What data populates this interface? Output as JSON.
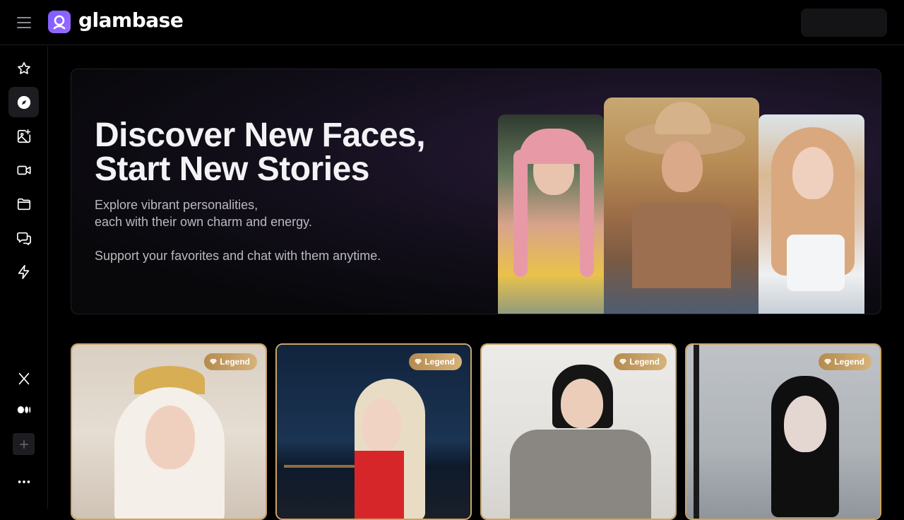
{
  "header": {
    "brand": "glambase"
  },
  "sidebar": {
    "items": [
      {
        "icon": "star-icon"
      },
      {
        "icon": "compass-icon",
        "active": true
      },
      {
        "icon": "image-plus-icon"
      },
      {
        "icon": "video-icon"
      },
      {
        "icon": "folder-icon"
      },
      {
        "icon": "chat-icon"
      },
      {
        "icon": "lightning-icon"
      }
    ],
    "footer": [
      {
        "icon": "x-icon"
      },
      {
        "icon": "medium-icon"
      },
      {
        "icon": "plus-icon"
      },
      {
        "icon": "more-icon"
      }
    ]
  },
  "hero": {
    "title_line1": "Discover New Faces,",
    "title_line2": "Start New Stories",
    "subtitle_line1": "Explore vibrant personalities,",
    "subtitle_line2": "each with their own charm and energy.",
    "subtitle_line3": "Support your favorites and chat with them anytime."
  },
  "cards": [
    {
      "badge": "Legend"
    },
    {
      "badge": "Legend"
    },
    {
      "badge": "Legend"
    },
    {
      "badge": "Legend"
    }
  ],
  "colors": {
    "accent": "#7c5cff",
    "gold": "#c9a46a",
    "background": "#000000"
  }
}
